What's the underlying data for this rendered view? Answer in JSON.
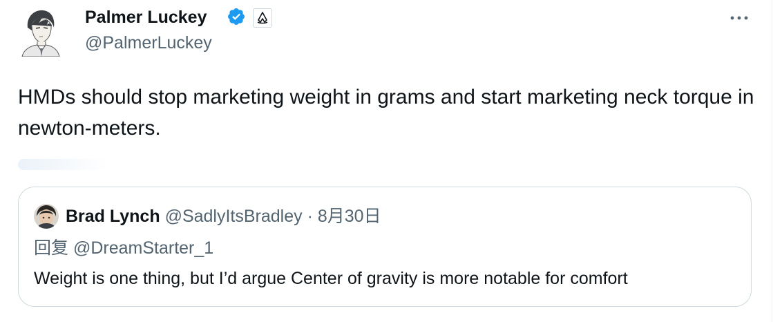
{
  "tweet": {
    "author": {
      "name": "Palmer Luckey",
      "handle": "@PalmerLuckey",
      "avatar_icon": "anime-portrait-avatar",
      "verified_icon": "verified-badge-icon",
      "affiliate_icon": "affiliate-logo-icon"
    },
    "more_icon": "more-options-icon",
    "text": "HMDs should stop marketing weight in grams and start marketing neck torque in newton-meters."
  },
  "quote": {
    "author": {
      "name": "Brad Lynch",
      "handle": "@SadlyItsBradley",
      "avatar_icon": "user-photo-avatar"
    },
    "separator": "·",
    "date": "8月30日",
    "reply_prefix": "回复",
    "reply_to": "@DreamStarter_1",
    "text": "Weight is one thing, but I’d argue Center of gravity is more notable for comfort"
  },
  "colors": {
    "text": "#0f1419",
    "secondary": "#536471",
    "border": "#cfd9de",
    "verified": "#1d9bf0"
  }
}
